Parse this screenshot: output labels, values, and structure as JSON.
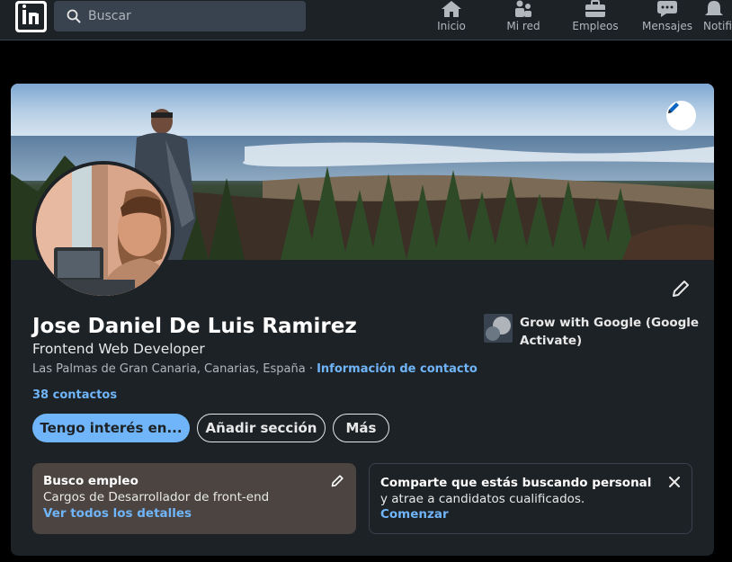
{
  "nav": {
    "search_placeholder": "Buscar",
    "items": [
      {
        "label": "Inicio",
        "icon": "home-icon"
      },
      {
        "label": "Mi red",
        "icon": "network-icon"
      },
      {
        "label": "Empleos",
        "icon": "briefcase-icon"
      },
      {
        "label": "Mensajes",
        "icon": "chat-icon"
      },
      {
        "label": "Notifi",
        "icon": "bell-icon"
      }
    ]
  },
  "profile": {
    "name": "Jose Daniel De Luis Ramirez",
    "headline": "Frontend Web Developer",
    "location": "Las Palmas de Gran Canaria, Canarias, España",
    "separator": " · ",
    "contact_info": "Información de contacto",
    "connections": "38 contactos",
    "company": "Grow with Google (Google Activate)"
  },
  "actions": {
    "open_to": "Tengo interés en...",
    "add_section": "Añadir sección",
    "more": "Más"
  },
  "open_to_work": {
    "title": "Busco empleo",
    "subtitle": "Cargos de Desarrollador de front-end",
    "link": "Ver todos los detalles"
  },
  "hiring": {
    "bold": "Comparte que estás buscando personal",
    "rest": " y atrae a candidatos cualificados.",
    "link": "Comenzar"
  },
  "colors": {
    "background": "#000000",
    "card": "#1d2226",
    "accent": "#70b5f9",
    "open_to_work_box": "#4b4440"
  }
}
